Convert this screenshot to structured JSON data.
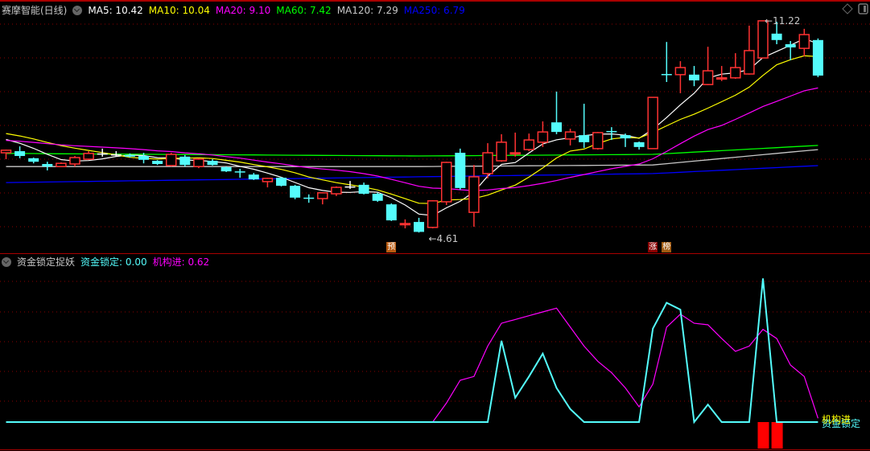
{
  "main_legend": {
    "title": "赛摩智能(日线)",
    "items": [
      {
        "label": "MA5: 10.42",
        "color": "#ffffff"
      },
      {
        "label": "MA10: 10.04",
        "color": "#ffff00"
      },
      {
        "label": "MA20: 9.10",
        "color": "#ff00ff"
      },
      {
        "label": "MA60: 7.42",
        "color": "#00ff00"
      },
      {
        "label": "MA120: 7.29",
        "color": "#c8c8c8"
      },
      {
        "label": "MA250: 6.79",
        "color": "#0000ff"
      }
    ]
  },
  "sub_legend": {
    "title": "资金锁定捉妖",
    "lock_label": "资金锁定: 0.00",
    "inst_label": "机构进: 0.62",
    "lock_name": "资金锁定",
    "inst_name": "机构进"
  },
  "markers": [
    {
      "text": "预",
      "index": 28,
      "color": "#b85a10"
    },
    {
      "text": "涨",
      "index": 47,
      "color": "#8a0000"
    },
    {
      "text": "榜",
      "index": 48,
      "color": "#a05a10"
    }
  ],
  "price_labels": {
    "low": "4.61",
    "low_index": 30,
    "high": "11.22",
    "high_index": 55
  },
  "colors": {
    "up": "#ff3232",
    "down": "#54fcfc",
    "flat": "#ffffff",
    "grid": "#8b0000",
    "signal": "#ff0000"
  },
  "chart_data": {
    "type": "candlestick",
    "price_range": [
      4.61,
      11.22
    ],
    "candles": [
      {
        "o": 7.1,
        "c": 7.18,
        "h": 7.2,
        "l": 6.9,
        "d": "up"
      },
      {
        "o": 7.15,
        "c": 7.0,
        "h": 7.3,
        "l": 6.93,
        "d": "down"
      },
      {
        "o": 6.93,
        "c": 6.82,
        "h": 6.95,
        "l": 6.77,
        "d": "down"
      },
      {
        "o": 6.75,
        "c": 6.67,
        "h": 6.82,
        "l": 6.55,
        "d": "down"
      },
      {
        "o": 6.67,
        "c": 6.77,
        "h": 6.8,
        "l": 6.65,
        "d": "up"
      },
      {
        "o": 6.75,
        "c": 6.95,
        "h": 7.0,
        "l": 6.67,
        "d": "up"
      },
      {
        "o": 6.9,
        "c": 7.08,
        "h": 7.15,
        "l": 6.88,
        "d": "up"
      },
      {
        "o": 7.08,
        "c": 7.08,
        "h": 7.23,
        "l": 6.98,
        "d": "flat"
      },
      {
        "o": 7.05,
        "c": 7.05,
        "h": 7.15,
        "l": 6.98,
        "d": "flat"
      },
      {
        "o": 7.03,
        "c": 6.98,
        "h": 7.08,
        "l": 6.95,
        "d": "down"
      },
      {
        "o": 7.0,
        "c": 6.88,
        "h": 7.1,
        "l": 6.77,
        "d": "down"
      },
      {
        "o": 6.85,
        "c": 6.75,
        "h": 6.87,
        "l": 6.72,
        "d": "down"
      },
      {
        "o": 6.7,
        "c": 7.05,
        "h": 7.1,
        "l": 6.67,
        "d": "up"
      },
      {
        "o": 6.98,
        "c": 6.72,
        "h": 7.03,
        "l": 6.67,
        "d": "down"
      },
      {
        "o": 6.67,
        "c": 6.9,
        "h": 6.93,
        "l": 6.62,
        "d": "up"
      },
      {
        "o": 6.85,
        "c": 6.72,
        "h": 6.9,
        "l": 6.7,
        "d": "down"
      },
      {
        "o": 6.65,
        "c": 6.52,
        "h": 6.67,
        "l": 6.5,
        "d": "down"
      },
      {
        "o": 6.52,
        "c": 6.52,
        "h": 6.6,
        "l": 6.32,
        "d": "down"
      },
      {
        "o": 6.42,
        "c": 6.27,
        "h": 6.47,
        "l": 6.25,
        "d": "down"
      },
      {
        "o": 6.2,
        "c": 6.3,
        "h": 6.32,
        "l": 6.02,
        "d": "up"
      },
      {
        "o": 6.32,
        "c": 6.07,
        "h": 6.34,
        "l": 6.05,
        "d": "down"
      },
      {
        "o": 6.07,
        "c": 5.7,
        "h": 6.1,
        "l": 5.65,
        "d": "down"
      },
      {
        "o": 5.7,
        "c": 5.7,
        "h": 5.8,
        "l": 5.54,
        "d": "down"
      },
      {
        "o": 5.67,
        "c": 5.85,
        "h": 5.87,
        "l": 5.49,
        "d": "up"
      },
      {
        "o": 5.82,
        "c": 6.02,
        "h": 6.05,
        "l": 5.75,
        "d": "up"
      },
      {
        "o": 6.05,
        "c": 6.05,
        "h": 6.22,
        "l": 5.97,
        "d": "flat"
      },
      {
        "o": 6.1,
        "c": 5.82,
        "h": 6.17,
        "l": 5.8,
        "d": "down"
      },
      {
        "o": 5.82,
        "c": 5.6,
        "h": 5.85,
        "l": 5.57,
        "d": "down"
      },
      {
        "o": 5.49,
        "c": 4.99,
        "h": 5.52,
        "l": 4.97,
        "d": "down"
      },
      {
        "o": 4.89,
        "c": 4.89,
        "h": 5.02,
        "l": 4.74,
        "d": "up"
      },
      {
        "o": 4.94,
        "c": 4.63,
        "h": 5.07,
        "l": 4.61,
        "d": "down"
      },
      {
        "o": 4.77,
        "c": 5.6,
        "h": 5.62,
        "l": 4.74,
        "d": "up"
      },
      {
        "o": 5.57,
        "c": 6.8,
        "h": 6.82,
        "l": 5.47,
        "d": "up"
      },
      {
        "o": 7.1,
        "c": 6.0,
        "h": 7.23,
        "l": 5.95,
        "d": "down"
      },
      {
        "o": 5.24,
        "c": 6.35,
        "h": 6.72,
        "l": 4.79,
        "d": "up"
      },
      {
        "o": 6.45,
        "c": 7.1,
        "h": 7.4,
        "l": 6.3,
        "d": "up"
      },
      {
        "o": 6.85,
        "c": 7.43,
        "h": 7.68,
        "l": 6.82,
        "d": "up"
      },
      {
        "o": 7.1,
        "c": 7.1,
        "h": 7.73,
        "l": 6.98,
        "d": "up"
      },
      {
        "o": 7.2,
        "c": 7.5,
        "h": 7.7,
        "l": 7.15,
        "d": "up"
      },
      {
        "o": 7.43,
        "c": 7.75,
        "h": 8.08,
        "l": 7.28,
        "d": "up"
      },
      {
        "o": 8.05,
        "c": 7.75,
        "h": 9.01,
        "l": 7.68,
        "d": "down"
      },
      {
        "o": 7.53,
        "c": 7.75,
        "h": 7.85,
        "l": 7.33,
        "d": "up"
      },
      {
        "o": 7.65,
        "c": 7.43,
        "h": 8.63,
        "l": 7.25,
        "d": "down"
      },
      {
        "o": 7.23,
        "c": 7.73,
        "h": 7.75,
        "l": 7.2,
        "d": "up"
      },
      {
        "o": 7.78,
        "c": 7.78,
        "h": 7.9,
        "l": 7.5,
        "d": "down"
      },
      {
        "o": 7.65,
        "c": 7.55,
        "h": 7.7,
        "l": 7.28,
        "d": "down"
      },
      {
        "o": 7.43,
        "c": 7.28,
        "h": 7.45,
        "l": 7.2,
        "d": "down"
      },
      {
        "o": 7.23,
        "c": 8.83,
        "h": 8.83,
        "l": 7.23,
        "d": "up"
      },
      {
        "o": 9.56,
        "c": 9.56,
        "h": 10.56,
        "l": 9.31,
        "d": "down"
      },
      {
        "o": 9.54,
        "c": 9.76,
        "h": 9.96,
        "l": 8.96,
        "d": "up"
      },
      {
        "o": 9.54,
        "c": 9.36,
        "h": 9.81,
        "l": 9.18,
        "d": "down"
      },
      {
        "o": 9.23,
        "c": 9.66,
        "h": 10.41,
        "l": 9.21,
        "d": "up"
      },
      {
        "o": 9.44,
        "c": 9.44,
        "h": 9.81,
        "l": 9.34,
        "d": "up"
      },
      {
        "o": 9.44,
        "c": 9.76,
        "h": 10.21,
        "l": 9.41,
        "d": "up"
      },
      {
        "o": 9.56,
        "c": 10.29,
        "h": 11.07,
        "l": 9.54,
        "d": "up"
      },
      {
        "o": 10.06,
        "c": 11.22,
        "h": 11.22,
        "l": 10.06,
        "d": "up"
      },
      {
        "o": 10.82,
        "c": 10.62,
        "h": 11.19,
        "l": 10.49,
        "d": "down"
      },
      {
        "o": 10.49,
        "c": 10.39,
        "h": 10.59,
        "l": 9.99,
        "d": "down"
      },
      {
        "o": 10.36,
        "c": 10.79,
        "h": 10.97,
        "l": 10.11,
        "d": "up"
      },
      {
        "o": 10.62,
        "c": 9.51,
        "h": 10.67,
        "l": 9.46,
        "d": "down"
      }
    ],
    "ma_short": [
      {
        "name": "MA5",
        "period": 5,
        "seed": 7.6,
        "color": "#ffffff"
      },
      {
        "name": "MA10",
        "period": 10,
        "seed": 7.76,
        "color": "#ffff00"
      },
      {
        "name": "MA20",
        "period": 20,
        "seed": 7.5,
        "color": "#ff00ff"
      }
    ],
    "ma_long": [
      {
        "name": "MA60",
        "color": "#00ff00",
        "anchors": [
          [
            0,
            7.08
          ],
          [
            30,
            7.0
          ],
          [
            47,
            7.05
          ],
          [
            59,
            7.33
          ]
        ]
      },
      {
        "name": "MA120",
        "color": "#c8c8c8",
        "anchors": [
          [
            0,
            6.67
          ],
          [
            30,
            6.67
          ],
          [
            47,
            6.72
          ],
          [
            59,
            7.2
          ]
        ]
      },
      {
        "name": "MA250",
        "color": "#0000ff",
        "anchors": [
          [
            0,
            6.17
          ],
          [
            30,
            6.35
          ],
          [
            47,
            6.45
          ],
          [
            59,
            6.7
          ]
        ]
      }
    ],
    "indicator": {
      "range": [
        0,
        20
      ],
      "lock": [
        0,
        0,
        0,
        0,
        0,
        0,
        0,
        0,
        0,
        0,
        0,
        0,
        0,
        0,
        0,
        0,
        0,
        0,
        0,
        0,
        0,
        0,
        0,
        0,
        0,
        0,
        0,
        0,
        0,
        0,
        0,
        0,
        0,
        0,
        0,
        0,
        10.7,
        3.2,
        6,
        9,
        4.5,
        1.7,
        0,
        0,
        0,
        0,
        0,
        12.3,
        15.7,
        14.8,
        0,
        2.3,
        0,
        0,
        0,
        18.9,
        0,
        0,
        0,
        0
      ],
      "inst": [
        0,
        0,
        0,
        0,
        0,
        0,
        0,
        0,
        0,
        0,
        0,
        0,
        0,
        0,
        0,
        0,
        0,
        0,
        0,
        0,
        0,
        0,
        0,
        0,
        0,
        0,
        0,
        0,
        0,
        0,
        0,
        0,
        2.5,
        5.5,
        6,
        10,
        13,
        13.5,
        14,
        14.5,
        15,
        12.5,
        10,
        8,
        6.5,
        4.5,
        2,
        5,
        12.5,
        14.2,
        13,
        12.8,
        11,
        9.3,
        10,
        12.2,
        11,
        7.5,
        6,
        0.5
      ],
      "signals": [
        55,
        56
      ]
    }
  }
}
